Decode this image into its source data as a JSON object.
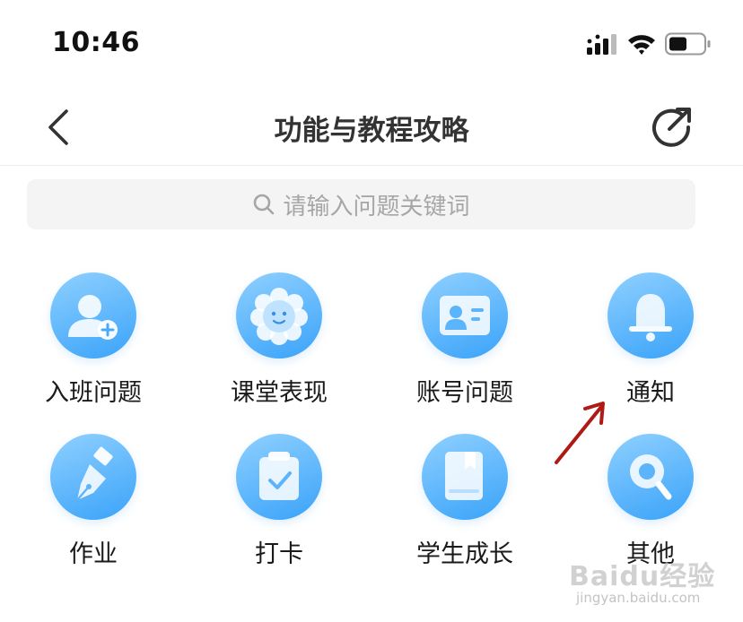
{
  "status_bar": {
    "time": "10:46",
    "icons": [
      "cellular-signal-icon",
      "wifi-icon",
      "battery-icon"
    ]
  },
  "nav": {
    "title": "功能与教程攻略",
    "back_icon": "chevron-left-icon",
    "share_icon": "share-out-icon"
  },
  "search": {
    "placeholder": "请输入问题关键词",
    "icon": "search-icon"
  },
  "categories": [
    {
      "label": "入班问题",
      "icon": "user-add-icon"
    },
    {
      "label": "课堂表现",
      "icon": "flower-smile-icon"
    },
    {
      "label": "账号问题",
      "icon": "id-card-icon"
    },
    {
      "label": "通知",
      "icon": "bell-icon"
    },
    {
      "label": "作业",
      "icon": "pen-nib-icon"
    },
    {
      "label": "打卡",
      "icon": "clipboard-check-icon"
    },
    {
      "label": "学生成长",
      "icon": "book-icon"
    },
    {
      "label": "其他",
      "icon": "magnifier-icon"
    }
  ],
  "watermark": {
    "brand": "Baidu经验",
    "url": "jingyan.baidu.com"
  },
  "colors": {
    "icon_gradient_start": "#8fd0ff",
    "icon_gradient_end": "#3aa3f9",
    "annotation_arrow": "#b01a14"
  }
}
